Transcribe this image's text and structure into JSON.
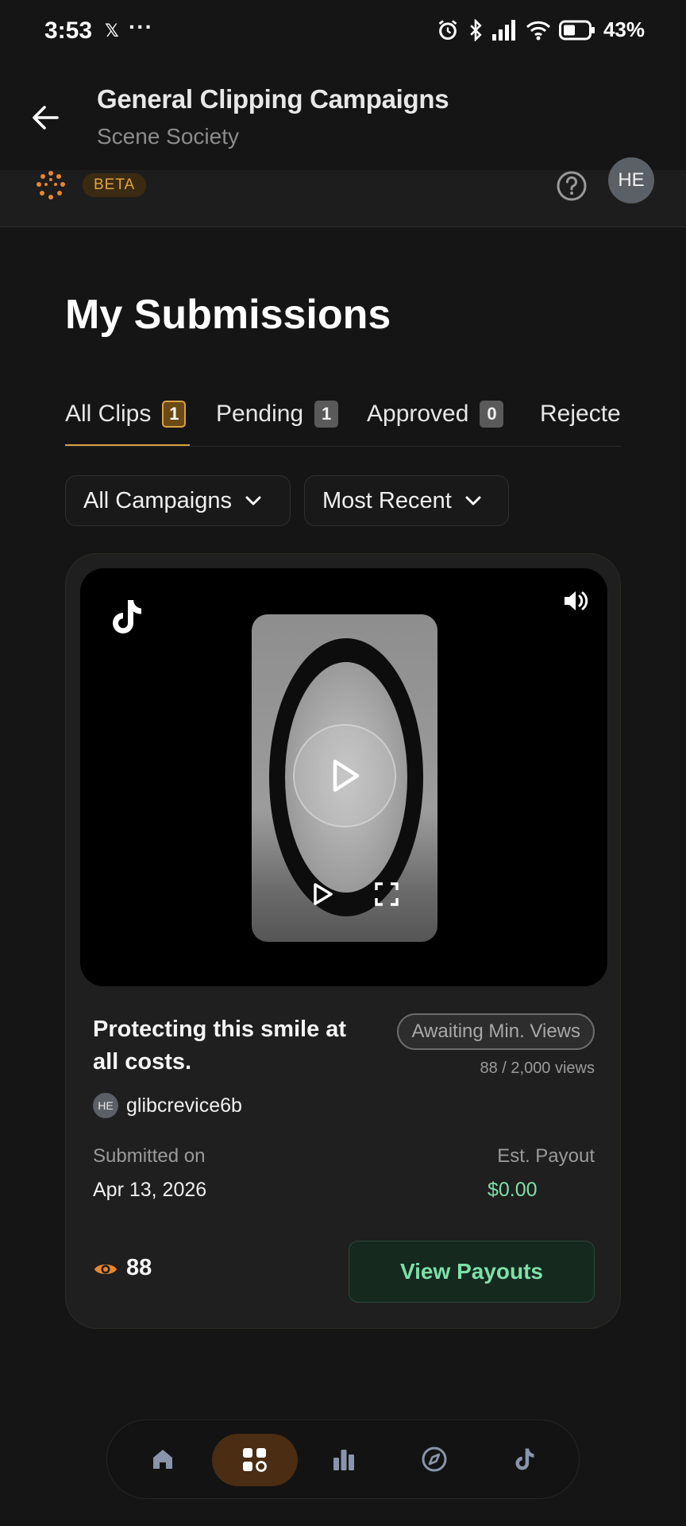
{
  "status_bar": {
    "time": "3:53",
    "x_icon": "x-logo",
    "dots": "···",
    "battery_percent": "43%"
  },
  "header": {
    "title": "General Clipping Campaigns",
    "subtitle": "Scene Society"
  },
  "subheader": {
    "beta": "BETA",
    "avatar_initials": "HE"
  },
  "page": {
    "title": "My Submissions"
  },
  "tabs": [
    {
      "label": "All Clips",
      "count": "1",
      "active": true
    },
    {
      "label": "Pending",
      "count": "1",
      "active": false
    },
    {
      "label": "Approved",
      "count": "0",
      "active": false
    },
    {
      "label": "Rejecte",
      "count": "",
      "active": false
    }
  ],
  "filters": {
    "campaign": "All Campaigns",
    "sort": "Most Recent"
  },
  "submission": {
    "title": "Protecting this smile at all costs.",
    "status": "Awaiting Min. Views",
    "views_progress": "88 / 2,000 views",
    "creator_initials": "HE",
    "creator": "glibcrevice6b",
    "submitted_label": "Submitted on",
    "submitted_date": "Apr 13, 2026",
    "payout_label": "Est. Payout",
    "payout_value": "$0.00",
    "view_count": "88",
    "view_payouts_label": "View Payouts"
  },
  "bottom_nav": [
    {
      "icon": "home-icon",
      "active": false
    },
    {
      "icon": "grid-icon",
      "active": true
    },
    {
      "icon": "bar-chart-icon",
      "active": false
    },
    {
      "icon": "compass-icon",
      "active": false
    },
    {
      "icon": "tiktok-icon",
      "active": false
    }
  ],
  "colors": {
    "accent": "#d8a043",
    "success": "#7ee0a8",
    "eye": "#e8862e"
  }
}
